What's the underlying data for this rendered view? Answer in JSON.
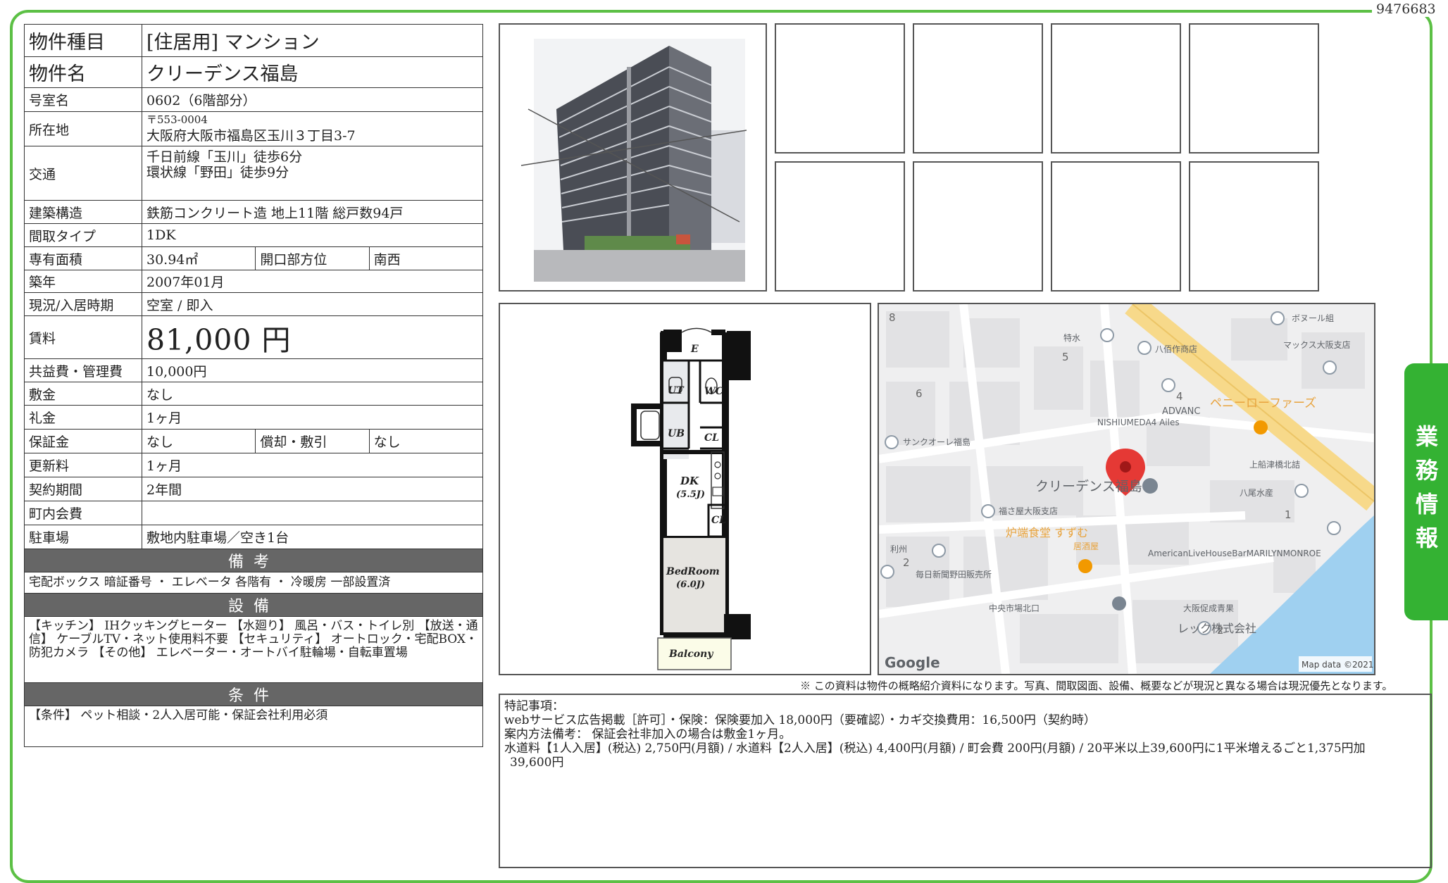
{
  "doc_id": "9476683",
  "spec": {
    "type_label": "物件種目",
    "type_value": "[住居用] マンション",
    "name_label": "物件名",
    "name_value": "クリーデンス福島",
    "room_label": "号室名",
    "room_value": "0602（6階部分）",
    "address_label": "所在地",
    "address_zip": "〒553-0004",
    "address_value": "大阪府大阪市福島区玉川３丁目3-7",
    "transit_label": "交通",
    "transit_1": "千日前線「玉川」徒歩6分",
    "transit_2": "環状線「野田」徒歩9分",
    "structure_label": "建築構造",
    "structure_value": "鉄筋コンクリート造 地上11階 総戸数94戸",
    "layout_label": "間取タイプ",
    "layout_value": "1DK",
    "area_label": "専有面積",
    "area_value": "30.94㎡",
    "opening_label": "開口部方位",
    "opening_value": "南西",
    "built_label": "築年",
    "built_value": "2007年01月",
    "status_label": "現況/入居時期",
    "status_value": "空室 / 即入",
    "rent_label": "賃料",
    "rent_value": "81,000 円",
    "fee_label": "共益費・管理費",
    "fee_value": "10,000円",
    "deposit_label": "敷金",
    "deposit_value": "なし",
    "key_money_label": "礼金",
    "key_money_value": "1ヶ月",
    "guarantee_label": "保証金",
    "guarantee_value": "なし",
    "amort_label": "償却・敷引",
    "amort_value": "なし",
    "renewal_label": "更新料",
    "renewal_value": "1ヶ月",
    "contract_label": "契約期間",
    "contract_value": "2年間",
    "assoc_label": "町内会費",
    "assoc_value": "",
    "parking_label": "駐車場",
    "parking_value": "敷地内駐車場／空き1台"
  },
  "sections": {
    "remarks_header": "備考",
    "remarks_text": "宅配ボックス 暗証番号 ・ エレベータ 各階有 ・ 冷暖房 一部設置済",
    "equipment_header": "設備",
    "equipment_text": "【キッチン】 IHクッキングヒーター 【水廻り】 風呂・バス・トイレ別 【放送・通信】 ケーブルTV・ネット使用料不要 【セキュリティ】 オートロック・宅配BOX・防犯カメラ 【その他】 エレベーター・オートバイ駐輪場・自転車置場",
    "conditions_header": "条件",
    "conditions_text": "【条件】 ペット相談・2人入居可能・保証会社利用必須"
  },
  "floorplan": {
    "entrance": "E",
    "ut": "UT",
    "wc": "WC",
    "ub": "UB",
    "cl1": "CL",
    "dk": "DK",
    "dk_size": "(5.5J)",
    "cl2": "CL",
    "bedroom": "BedRoom",
    "bedroom_size": "(6.0J)",
    "balcony": "Balcony"
  },
  "map": {
    "pin_label": "クリーデンス福島",
    "labels": [
      "ボヌール組",
      "マックス大阪支店",
      "特水",
      "八佰作商店",
      "ADVANC",
      "NISHIUMEDA4 Ailes",
      "ペニーローファーズ",
      "サンクオーレ福島",
      "上船津橋北詰",
      "八尾水産",
      "福さ屋大阪支店",
      "炉端食堂 すずむ",
      "居酒屋",
      "AmericanLiveHouseBarMARILYNMONROE",
      "利州",
      "毎日新聞野田販売所",
      "中央市場北口",
      "レック株式会社",
      "大阪促成青果"
    ],
    "numbers": [
      "8",
      "5",
      "6",
      "4",
      "2",
      "1",
      "2"
    ],
    "logo": "Google",
    "credit": "Map data ©2021"
  },
  "disclaimer": "※ この資料は物件の概略紹介資料になります。写真、間取図面、設備、概要などが現況と異なる場合は現況優先となります。",
  "remarks_box": {
    "line1": "特記事項：",
    "line2": "webサービス広告掲載［許可］・保険：保険要加入 18,000円（要確認）・カギ交換費用：16,500円（契約時）",
    "line3": "案内方法備考： 保証会社非加入の場合は敷金1ヶ月。",
    "line4": "水道料【1人入居】(税込) 2,750円(月額) / 水道料【2人入居】(税込) 4,400円(月額) / 町会費 200円(月額) / 20平米以上39,600円に1平米増えるごと1,375円加",
    "line5": "39,600円"
  },
  "side_tab": [
    "業",
    "務",
    "情",
    "報"
  ],
  "colors": {
    "frame": "#5cc045",
    "tab": "#34b233",
    "header_bg": "#666666",
    "map_bg": "#efeff0",
    "water": "#9fd0f0",
    "highway": "#f7d98a",
    "pin": "#e53935"
  }
}
